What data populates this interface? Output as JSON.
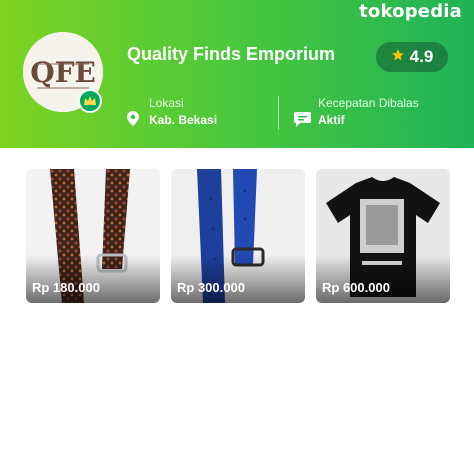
{
  "app": {
    "brand": "tokopedia",
    "accent": "#00aa5b"
  },
  "shop": {
    "logo_text": "QFE",
    "name": "Quality Finds Emporium",
    "rating": "4.9",
    "badge_icon": "crown-icon",
    "location_label": "Lokasi",
    "location_value": "Kab. Bekasi",
    "response_label": "Kecepatan Dibalas",
    "response_value": "Aktif"
  },
  "products": [
    {
      "price": "Rp 180.000",
      "image": "brown-patterned-watch-strap"
    },
    {
      "price": "Rp 300.000",
      "image": "blue-watch-strap"
    },
    {
      "price": "Rp 600.000",
      "image": "black-graphic-tshirt"
    }
  ]
}
